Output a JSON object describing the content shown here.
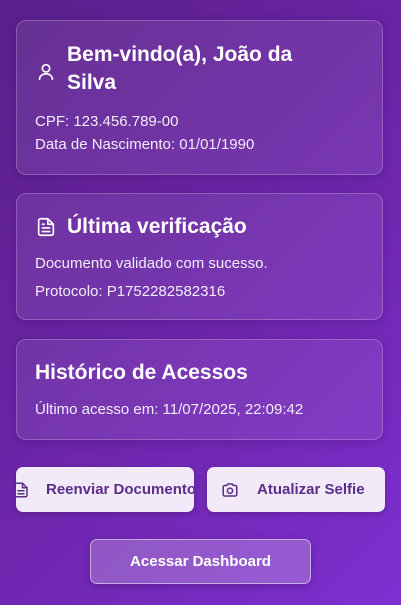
{
  "welcome": {
    "icon": "user-icon",
    "title": "Bem-vindo(a), João da Silva",
    "cpf": "CPF: 123.456.789-00",
    "birth_date": "Data de Nascimento: 01/01/1990"
  },
  "verification": {
    "icon": "document-icon",
    "title": "Última verificação",
    "status": "Documento validado com sucesso.",
    "protocol": "Protocolo: P1752282582316"
  },
  "history": {
    "title": "Histórico de Acessos",
    "last_access": "Último acesso em: 11/07/2025, 22:09:42"
  },
  "actions": {
    "resend_label": "Reenviar Documento",
    "resend_icon": "document-icon",
    "selfie_label": "Atualizar Selfie",
    "selfie_icon": "camera-icon",
    "dashboard_label": "Acessar Dashboard"
  },
  "colors": {
    "background_start": "#5a1f8a",
    "background_end": "#7f2fd0",
    "button_text": "#5a2d8a",
    "button_bg": "#f2eaf8"
  }
}
